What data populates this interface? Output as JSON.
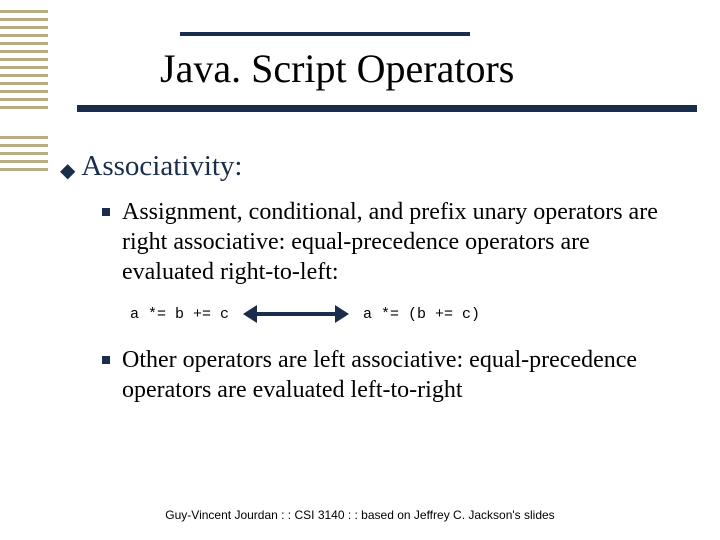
{
  "title": "Java. Script Operators",
  "bullet": {
    "heading": "Associativity:",
    "items": [
      "Assignment, conditional, and prefix unary operators are right associative: equal-precedence operators are evaluated right-to-left:",
      "Other operators are left associative: equal-precedence operators are evaluated left-to-right"
    ]
  },
  "code": {
    "left": "a *= b += c",
    "right": "a *= (b += c)"
  },
  "footer": "Guy-Vincent Jourdan : : CSI 3140 : : based on Jeffrey C. Jackson's slides"
}
